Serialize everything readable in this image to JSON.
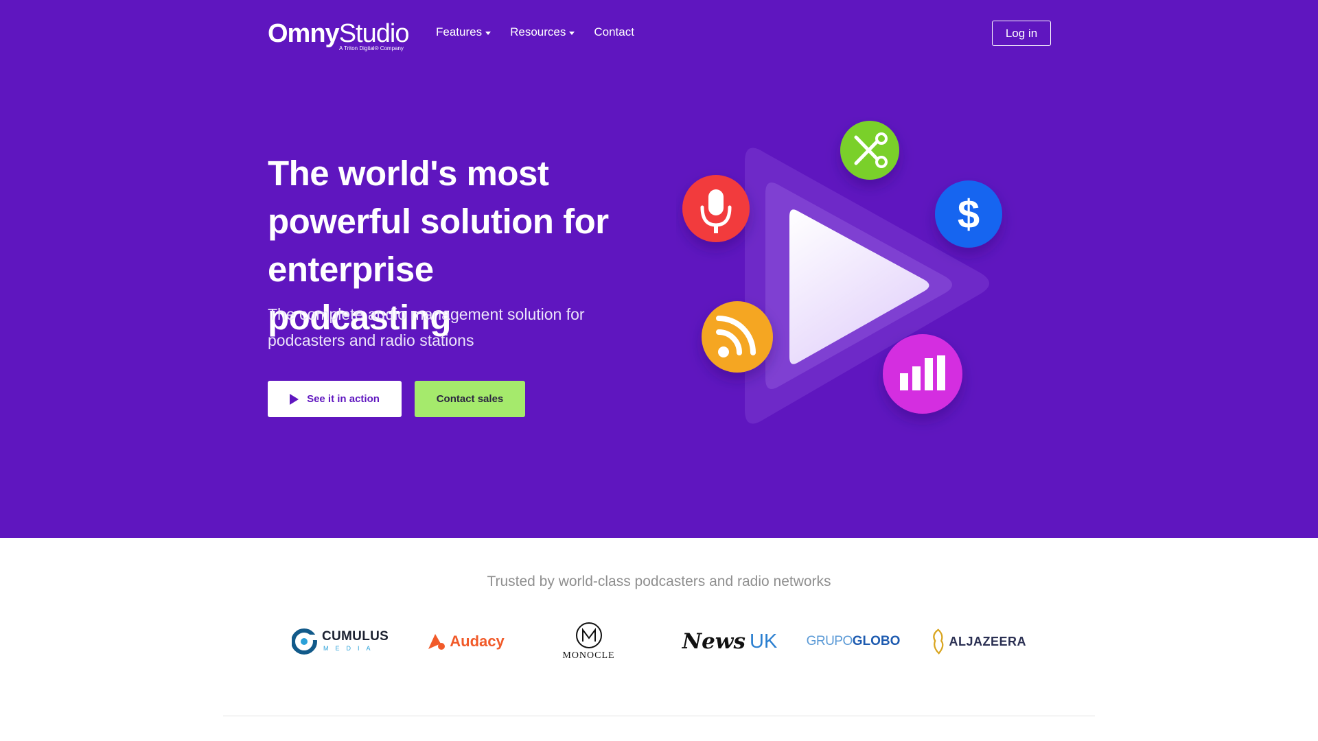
{
  "header": {
    "logo": {
      "name": "OmnyStudio",
      "omny": "Omny",
      "studio": "Studio",
      "tagline": "A Triton Digital® Company"
    },
    "nav": [
      {
        "label": "Features",
        "dropdown": true
      },
      {
        "label": "Resources",
        "dropdown": true
      },
      {
        "label": "Contact",
        "dropdown": false
      }
    ],
    "login_label": "Log in"
  },
  "hero": {
    "headline": "The world's most powerful solution for enterprise podcasting",
    "subhead": "The complete audio management solution for podcasters and radio stations",
    "primary_button": {
      "label": "See it in action",
      "icon": "play-icon"
    },
    "secondary_button": {
      "label": "Contact sales"
    },
    "illustration": {
      "center_icon": "play-icon",
      "icons": [
        {
          "name": "microphone-icon",
          "color": "#f23a3c"
        },
        {
          "name": "scissors-icon",
          "color": "#7ad02a"
        },
        {
          "name": "dollar-icon",
          "color": "#1565f0"
        },
        {
          "name": "rss-icon",
          "color": "#f5a623"
        },
        {
          "name": "bar-chart-icon",
          "color": "#d42fe0"
        }
      ]
    }
  },
  "trusted": {
    "title": "Trusted by world-class podcasters and radio networks",
    "logos": [
      {
        "name": "CUMULUS",
        "sub": "MEDIA"
      },
      {
        "name": "Audacy"
      },
      {
        "name": "MONOCLE"
      },
      {
        "name": "News",
        "suffix": "UK"
      },
      {
        "name": "GRUPO",
        "suffix": "GLOBO"
      },
      {
        "name": "ALJAZEERA"
      }
    ]
  },
  "colors": {
    "brand_purple": "#5f16bf",
    "cta_green": "#a5ea6c",
    "white": "#ffffff"
  }
}
